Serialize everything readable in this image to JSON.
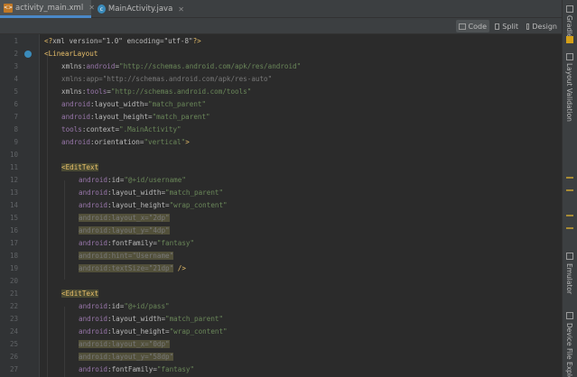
{
  "tabs": [
    {
      "label": "activity_main.xml",
      "icon": "xml-file-icon",
      "active": true
    },
    {
      "label": "MainActivity.java",
      "icon": "java-class-icon",
      "active": false
    }
  ],
  "view_modes": [
    {
      "label": "Code",
      "active": true
    },
    {
      "label": "Split",
      "active": false
    },
    {
      "label": "Design",
      "active": false
    }
  ],
  "right_sidebar": [
    {
      "label": "Gradle"
    },
    {
      "label": "Layout Validation"
    },
    {
      "label": "Emulator"
    },
    {
      "label": "Device File Explorer"
    }
  ],
  "gutter": {
    "line_numbers": [
      "1",
      "2",
      "3",
      "4",
      "5",
      "6",
      "7",
      "8",
      "9",
      "10",
      "11",
      "12",
      "13",
      "14",
      "15",
      "16",
      "17",
      "18",
      "19",
      "20",
      "21",
      "22",
      "23",
      "24",
      "25",
      "26",
      "27"
    ]
  },
  "code": {
    "l1": {
      "a": "<?",
      "b": "xml version=\"1.0\" encoding=\"utf-8\"",
      "c": "?>"
    },
    "l2": {
      "a": "<",
      "b": "LinearLayout"
    },
    "l3": {
      "ns": "xmlns:",
      "attr": "android",
      "eq": "=",
      "val": "\"http://schemas.android.com/apk/res/android\""
    },
    "l4": {
      "ns": "xmlns:",
      "attr": "app",
      "eq": "=",
      "val": "\"http://schemas.android.com/apk/res-auto\""
    },
    "l5": {
      "ns": "xmlns:",
      "attr": "tools",
      "eq": "=",
      "val": "\"http://schemas.android.com/tools\""
    },
    "l6": {
      "ns": "android",
      "attr": ":layout_width",
      "eq": "=",
      "val": "\"match_parent\""
    },
    "l7": {
      "ns": "android",
      "attr": ":layout_height",
      "eq": "=",
      "val": "\"match_parent\""
    },
    "l8": {
      "ns": "tools",
      "attr": ":context",
      "eq": "=",
      "val": "\".MainActivity\""
    },
    "l9": {
      "ns": "android",
      "attr": ":orientation",
      "eq": "=",
      "val": "\"vertical\"",
      "end": ">"
    },
    "l11": {
      "a": "<",
      "b": "EditText"
    },
    "l12": {
      "ns": "android",
      "attr": ":id",
      "eq": "=",
      "val": "\"@+id/username\""
    },
    "l13": {
      "ns": "android",
      "attr": ":layout_width",
      "eq": "=",
      "val": "\"match_parent\""
    },
    "l14": {
      "ns": "android",
      "attr": ":layout_height",
      "eq": "=",
      "val": "\"wrap_content\""
    },
    "l15": {
      "ns": "android",
      "attr": ":layout_x",
      "eq": "=",
      "val": "\"2dp\""
    },
    "l16": {
      "ns": "android",
      "attr": ":layout_y",
      "eq": "=",
      "val": "\"4dp\""
    },
    "l17": {
      "ns": "android",
      "attr": ":fontFamily",
      "eq": "=",
      "val": "\"fantasy\""
    },
    "l18": {
      "ns": "android",
      "attr": ":hint",
      "eq": "=",
      "val": "\"Username\""
    },
    "l19": {
      "ns": "android",
      "attr": ":textSize",
      "eq": "=",
      "val": "\"21dp\"",
      "end": " />"
    },
    "l21": {
      "a": "<",
      "b": "EditText"
    },
    "l22": {
      "ns": "android",
      "attr": ":id",
      "eq": "=",
      "val": "\"@+id/pass\""
    },
    "l23": {
      "ns": "android",
      "attr": ":layout_width",
      "eq": "=",
      "val": "\"match_parent\""
    },
    "l24": {
      "ns": "android",
      "attr": ":layout_height",
      "eq": "=",
      "val": "\"wrap_content\""
    },
    "l25": {
      "ns": "android",
      "attr": ":layout_x",
      "eq": "=",
      "val": "\"0dp\""
    },
    "l26": {
      "ns": "android",
      "attr": ":layout_y",
      "eq": "=",
      "val": "\"58dp\""
    },
    "l27": {
      "ns": "android",
      "attr": ":fontFamily",
      "eq": "=",
      "val": "\"fantasy\""
    }
  }
}
